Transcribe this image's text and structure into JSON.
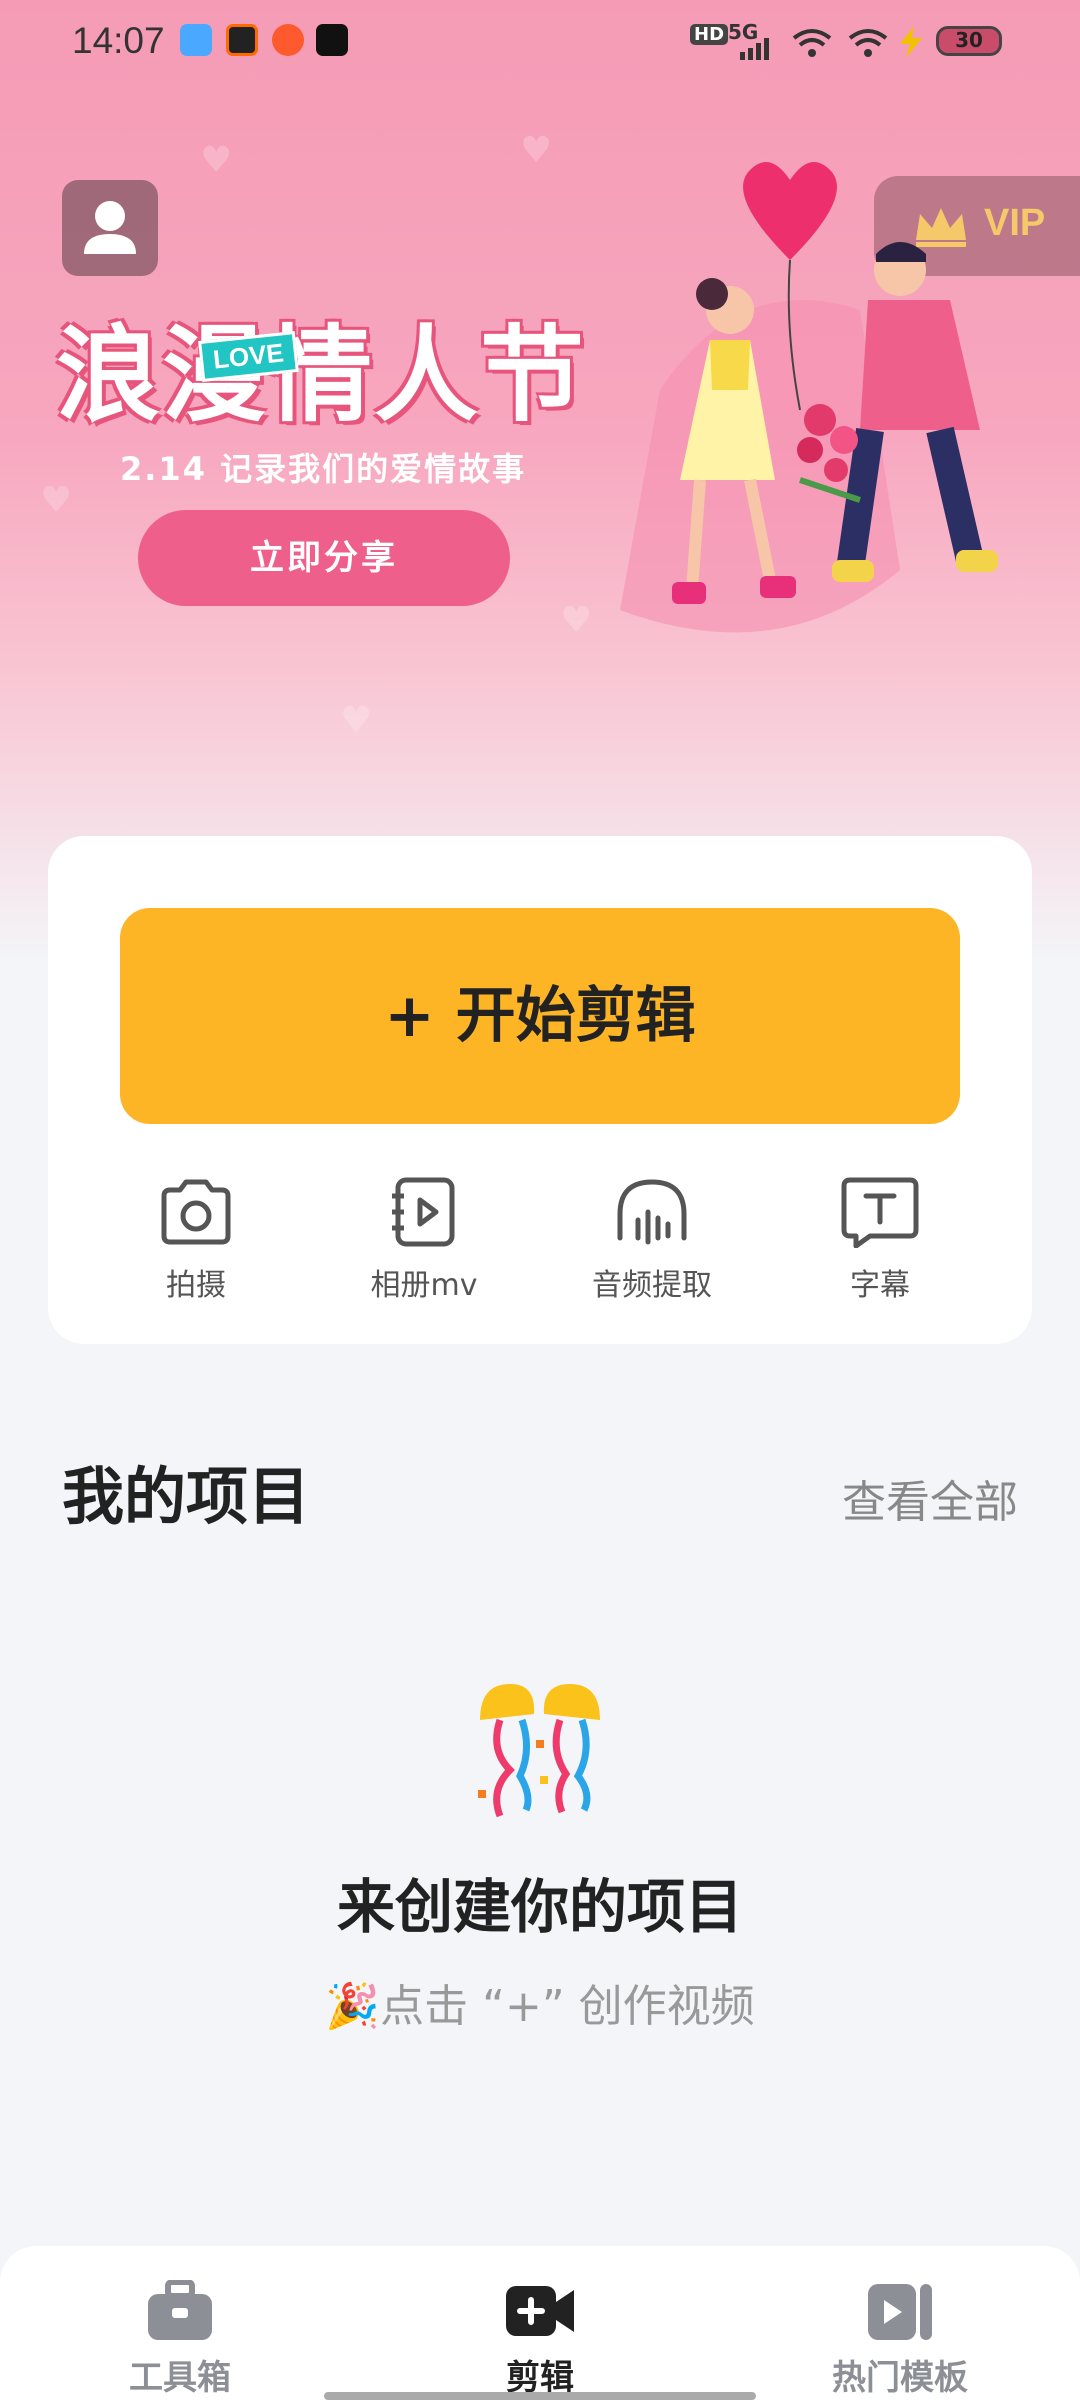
{
  "status_bar": {
    "time": "14:07",
    "network": "5G",
    "hd": "HD",
    "battery": "30"
  },
  "banner": {
    "headline": "浪漫情人节",
    "love_tag": "LOVE",
    "subtitle": "2.14 记录我们的爱情故事",
    "share_button": "立即分享",
    "vip": "VIP"
  },
  "actions": {
    "start_edit": "+ 开始剪辑",
    "tools": [
      {
        "label": "拍摄",
        "icon": "camera-icon"
      },
      {
        "label": "相册mv",
        "icon": "album-mv-icon"
      },
      {
        "label": "音频提取",
        "icon": "headphones-icon"
      },
      {
        "label": "字幕",
        "icon": "subtitle-icon"
      }
    ]
  },
  "projects": {
    "title": "我的项目",
    "view_all": "查看全部",
    "empty_title": "来创建你的项目",
    "empty_hint": "🎉点击 “+” 创作视频"
  },
  "bottom_nav": [
    {
      "label": "工具箱",
      "icon": "toolbox-icon",
      "active": false
    },
    {
      "label": "剪辑",
      "icon": "video-add-icon",
      "active": true
    },
    {
      "label": "热门模板",
      "icon": "template-icon",
      "active": false
    }
  ],
  "colors": {
    "accent_yellow": "#fdb526",
    "banner_pink": "#f7a7bf",
    "share_pink": "#ef5f8c"
  }
}
